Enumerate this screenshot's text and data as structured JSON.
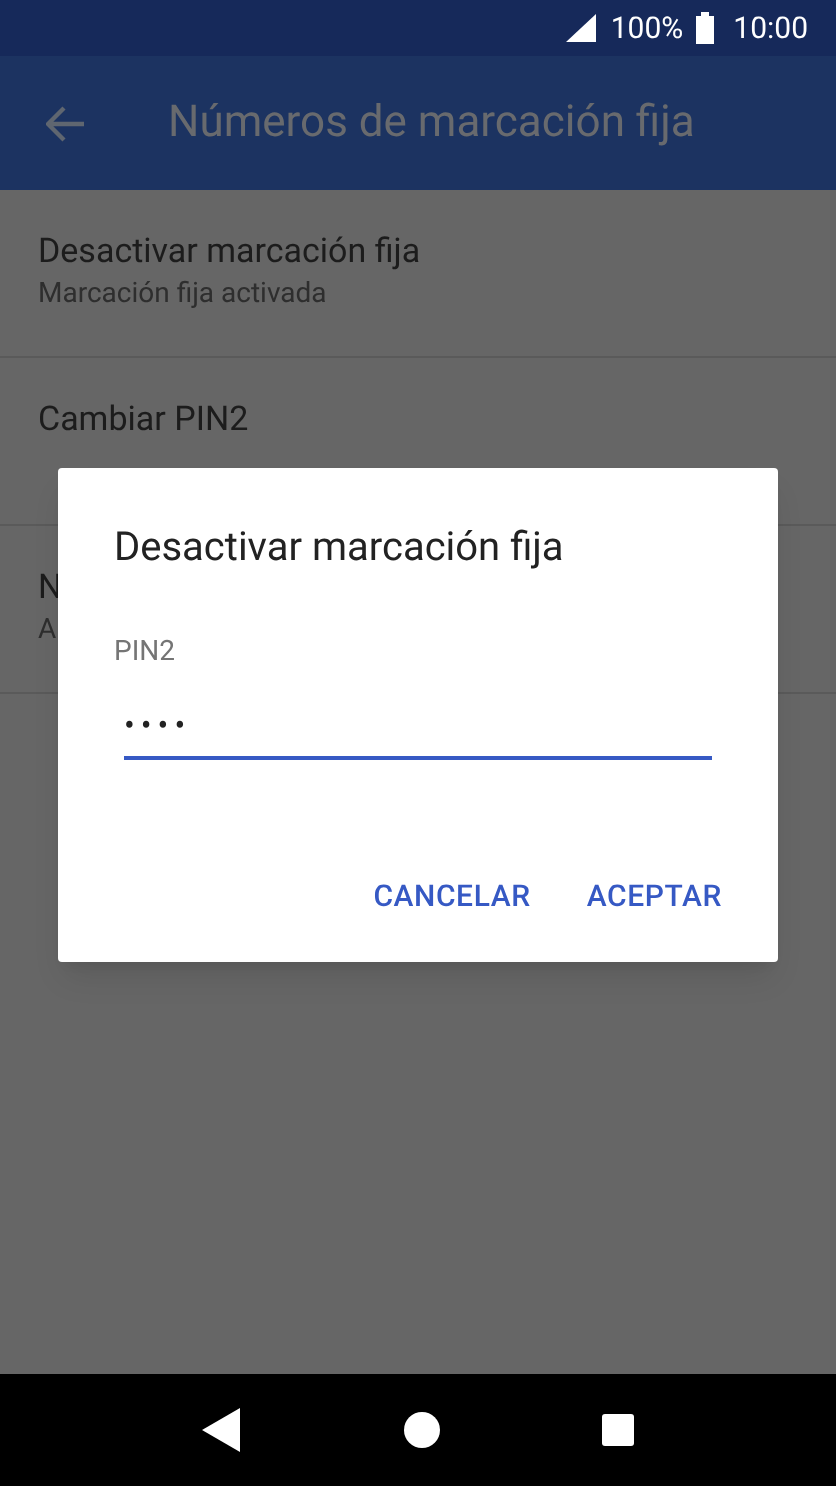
{
  "status_bar": {
    "battery": "100%",
    "time": "10:00"
  },
  "app_bar": {
    "title": "Números de marcación fija"
  },
  "list": [
    {
      "title": "Desactivar marcación fija",
      "subtitle": "Marcación fija activada"
    },
    {
      "title": "Cambiar PIN2"
    },
    {
      "title": "N",
      "subtitle": "A"
    }
  ],
  "dialog": {
    "title": "Desactivar marcación fija",
    "field": {
      "label": "PIN2",
      "value": "••••"
    },
    "buttons": [
      "CANCELAR",
      "ACEPTAR"
    ]
  }
}
